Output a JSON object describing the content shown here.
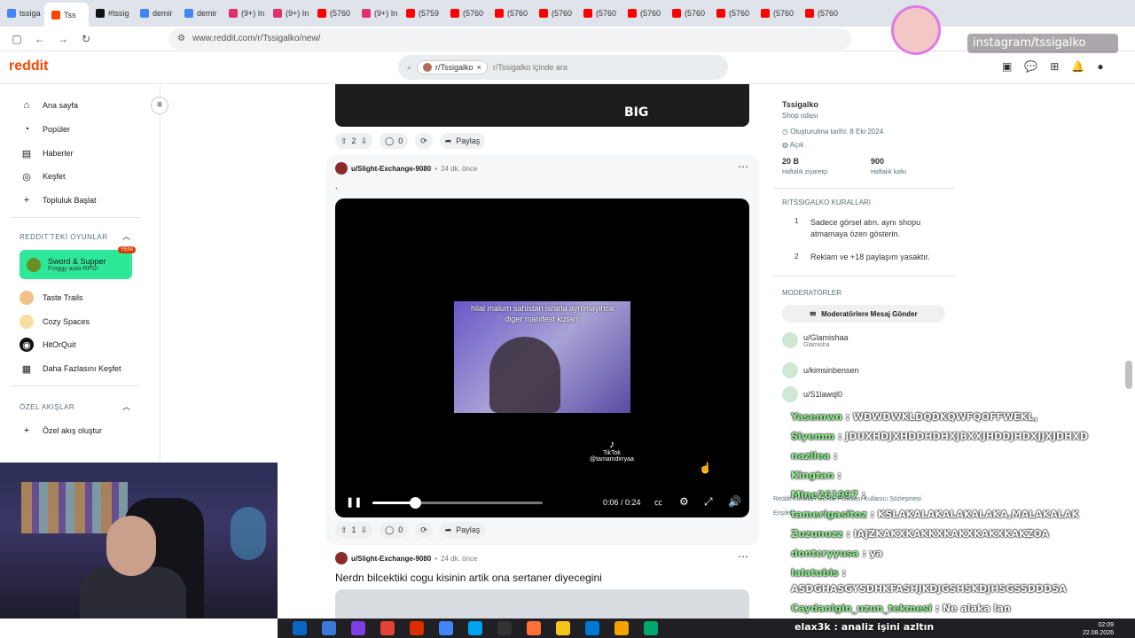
{
  "browser": {
    "tabs": [
      {
        "label": "tssiga",
        "color": "#4285f4"
      },
      {
        "label": "Tss",
        "color": "#ff4500",
        "active": true
      },
      {
        "label": "#tssig",
        "color": "#111111"
      },
      {
        "label": "demir",
        "color": "#4285f4"
      },
      {
        "label": "demir",
        "color": "#4285f4"
      },
      {
        "label": "(9+) In",
        "color": "#e1306c"
      },
      {
        "label": "(9+) In",
        "color": "#e1306c"
      },
      {
        "label": "(5760",
        "color": "#ff0000"
      },
      {
        "label": "(9+) In",
        "color": "#e1306c"
      },
      {
        "label": "(5759",
        "color": "#ff0000"
      },
      {
        "label": "(5760",
        "color": "#ff0000"
      },
      {
        "label": "(5760",
        "color": "#ff0000"
      },
      {
        "label": "(5760",
        "color": "#ff0000"
      },
      {
        "label": "(5760",
        "color": "#ff0000"
      },
      {
        "label": "(5760",
        "color": "#ff0000"
      },
      {
        "label": "(5760",
        "color": "#ff0000"
      },
      {
        "label": "(5760",
        "color": "#ff0000"
      },
      {
        "label": "(5760",
        "color": "#ff0000"
      },
      {
        "label": "(5760",
        "color": "#ff0000"
      }
    ],
    "url": "www.reddit.com/r/Tssigalko/new/"
  },
  "header": {
    "logo": "reddit",
    "search_chip": "r/Tssigalko",
    "search_placeholder": "r/Tssigalko içinde ara"
  },
  "sidebar": {
    "items": [
      {
        "label": "Ana sayfa",
        "icon": "home-icon"
      },
      {
        "label": "Popüler",
        "icon": "popular-icon"
      },
      {
        "label": "Haberler",
        "icon": "news-icon"
      },
      {
        "label": "Keşfet",
        "icon": "explore-icon"
      },
      {
        "label": "Topluluk Başlat",
        "icon": "plus-icon"
      }
    ],
    "games_heading": "REDDIT'TEKİ OYUNLAR",
    "featured_game": {
      "title": "Sword & Supper",
      "subtitle": "Froggy auto-RPG!",
      "badge": "YENİ"
    },
    "games": [
      "Taste Trails",
      "Cozy Spaces",
      "HitOrQuit",
      "Daha Fazlasını Keşfet"
    ],
    "custom_heading": "ÖZEL AKIŞLAR",
    "custom_create": "Özel akış oluştur"
  },
  "feed": {
    "post0": {
      "votes": "2",
      "comments": "0",
      "share": "Paylaş",
      "overlay": "BIG"
    },
    "post1": {
      "user": "u/Slight-Exchange-9080",
      "time": "24 dk. önce",
      "title": ".",
      "video_caption_1": "hilal malum sahistan israrla ayrilmayinca",
      "video_caption_2": "diger manifest kizlari:",
      "tiktok": "TikTok",
      "tiktok_user": "@tamamdirryaa",
      "time_display": "0:06 / 0:24",
      "progress": 0.25,
      "votes": "1",
      "comments": "0",
      "share": "Paylaş"
    },
    "post2": {
      "user": "u/Slight-Exchange-9080",
      "time": "24 dk. önce",
      "title": "Nerdn bilcektiki cogu kisinin artik ona sertaner diyecegini"
    }
  },
  "right": {
    "name": "Tssigalko",
    "desc": "Shop odası",
    "created": "Oluşturulma tarihi: 8 Eki 2024",
    "status": "Açık",
    "visitors_value": "20 B",
    "visitors_label": "Haftalık ziyaretçi",
    "contrib_value": "900",
    "contrib_label": "Haftalık katkı",
    "rules_heading": "R/TSSIGALKO KURALLARI",
    "rules": [
      {
        "n": "1",
        "text": "Sadece görsel atın. aynı shopu atmamaya özen gösterin."
      },
      {
        "n": "2",
        "text": "Reklam ve +18 paylaşım yasaktır."
      }
    ],
    "mods_heading": "MODERATÖRLER",
    "mod_button": "Moderatörlere Mesaj Gönder",
    "mods": [
      {
        "name": "u/Glamishaa",
        "sub": "Glamisha"
      },
      {
        "name": "u/kimsinbensen",
        "sub": ""
      },
      {
        "name": "u/S1lawql0",
        "sub": ""
      }
    ],
    "footer1": "Reddit Kuralları   Gizlilik Politikası   Kullanıcı Sözleşmesi",
    "footer2": "Erişileb"
  },
  "overlay": {
    "instagram": "instagram/tssigalko",
    "chat": [
      {
        "user": "Yasemwn",
        "msg": ": WDWDWKLDQDKQWFQOFFWEKL,"
      },
      {
        "user": "Siyemm",
        "msg": ": JDUXHDJXHDDHDHXJBXXJHDDJHDXJJXJDHXD"
      },
      {
        "user": "nazllea",
        "msg": ":"
      },
      {
        "user": "Kingtan",
        "msg": ":"
      },
      {
        "user": "Mine261997",
        "msg": ":"
      },
      {
        "user": "tamerigasitoz",
        "msg": ": KSLAKALAKALAKALAKA,MALAKALAK"
      },
      {
        "user": "Zuzunuzz",
        "msg": ": IAJZKAKXKAKKXKAKXKAKXKAKZOA"
      },
      {
        "user": "dontcryyusa",
        "msg": ": ya"
      },
      {
        "user": "lalatubis",
        "msg": ":"
      },
      {
        "user": "",
        "msg": "ASDGHASGYSDHKFASHJKDJGSHSKDJHSGSSDDDSA"
      },
      {
        "user": "Caydanlgin_uzun_tekmesi",
        "msg": ": Ne alaka lan"
      }
    ],
    "bottom_chat": "elax3k : analiz işini azltın"
  },
  "system": {
    "time": "02:09",
    "date": "22.08.2026"
  }
}
